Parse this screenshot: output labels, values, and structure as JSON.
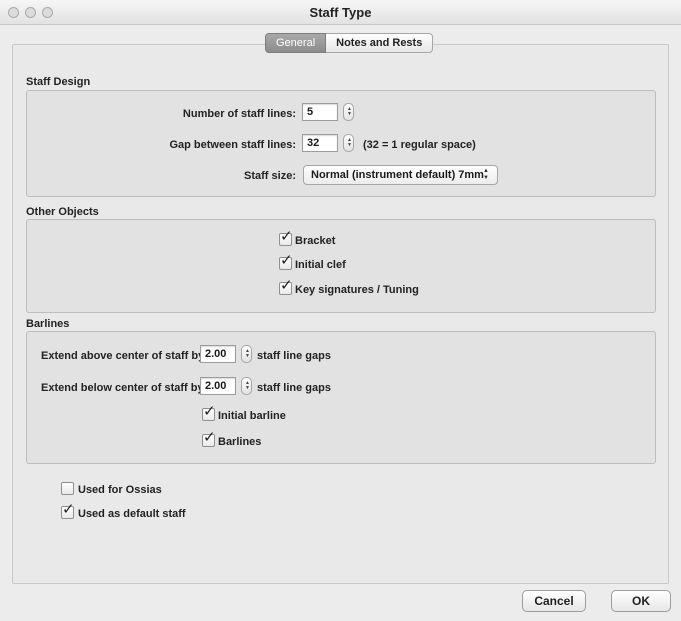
{
  "window": {
    "title": "Staff Type"
  },
  "tabs": [
    {
      "label": "General",
      "active": true
    },
    {
      "label": "Notes and Rests",
      "active": false
    }
  ],
  "staff_design": {
    "section_label": "Staff Design",
    "num_lines_label": "Number of staff lines:",
    "num_lines_value": "5",
    "gap_label": "Gap between staff lines:",
    "gap_value": "32",
    "gap_note": "(32 = 1 regular space)",
    "size_label": "Staff size:",
    "size_value": "Normal (instrument default) 7mm"
  },
  "other_objects": {
    "section_label": "Other Objects",
    "items": [
      {
        "label": "Bracket",
        "checked": true
      },
      {
        "label": "Initial clef",
        "checked": true
      },
      {
        "label": "Key signatures / Tuning",
        "checked": true
      }
    ]
  },
  "barlines": {
    "section_label": "Barlines",
    "above_label": "Extend above center of staff by",
    "above_value": "2.00",
    "below_label": "Extend below center of staff by",
    "below_value": "2.00",
    "unit_label": "staff line gaps",
    "items": [
      {
        "label": "Initial barline",
        "checked": true
      },
      {
        "label": "Barlines",
        "checked": true
      }
    ]
  },
  "options": [
    {
      "label": "Used for Ossias",
      "checked": false
    },
    {
      "label": "Used as default staff",
      "checked": true
    }
  ],
  "buttons": {
    "cancel": "Cancel",
    "ok": "OK"
  },
  "check_glyph": "✓"
}
